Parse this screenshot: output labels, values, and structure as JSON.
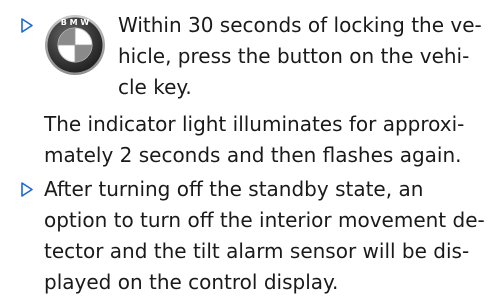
{
  "items": [
    {
      "lines": [
        "Within 30 seconds of locking the ve-",
        "hicle, press the button on the vehi-",
        "cle key."
      ],
      "icon": "bmw-logo-icon"
    },
    {
      "lines": [
        "The indicator light illuminates for approxi-",
        "mately 2 seconds and then flashes again."
      ]
    },
    {
      "lines": [
        "After turning off the standby state, an",
        "option to turn off the interior movement de-",
        "tector and the tilt alarm sensor will be dis-",
        "played on the control display."
      ]
    }
  ],
  "colors": {
    "bullet": "#1c69d4",
    "text": "#1a1a1a"
  }
}
